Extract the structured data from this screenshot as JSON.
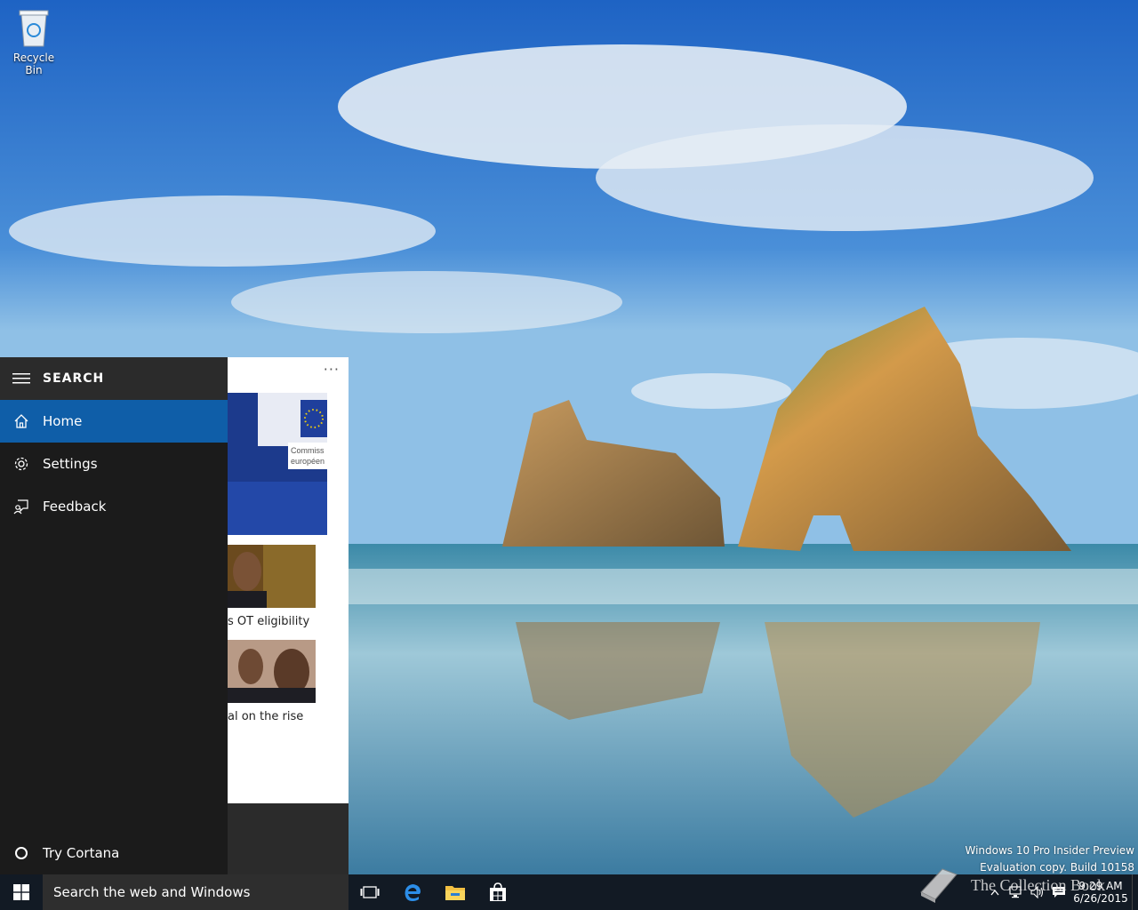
{
  "desktop": {
    "recycle_bin_label": "Recycle Bin",
    "watermark_line1": "Windows 10 Pro Insider Preview",
    "watermark_line2": "Evaluation copy. Build 10158"
  },
  "cortana": {
    "menu_title": "SEARCH",
    "menu_items": [
      {
        "label": "Home",
        "icon": "home-icon",
        "active": true
      },
      {
        "label": "Settings",
        "icon": "gear-icon",
        "active": false
      },
      {
        "label": "Feedback",
        "icon": "feedback-icon",
        "active": false
      }
    ],
    "try_cortana": "Try Cortana",
    "more_label": "···",
    "news": [
      {
        "caption": ""
      },
      {
        "caption": "s OT eligibility"
      },
      {
        "caption": "al on the rise"
      }
    ],
    "eu_text_1": "Commiss",
    "eu_text_2": "européen"
  },
  "taskbar": {
    "search_placeholder": "Search the web and Windows",
    "time": "9:29 AM",
    "date": "6/26/2015",
    "brand_watermark": "The Collection Book"
  },
  "colors": {
    "accent": "#0f5ea8",
    "menu_bg": "#1b1b1b",
    "taskbar_bg": "#121a24"
  }
}
